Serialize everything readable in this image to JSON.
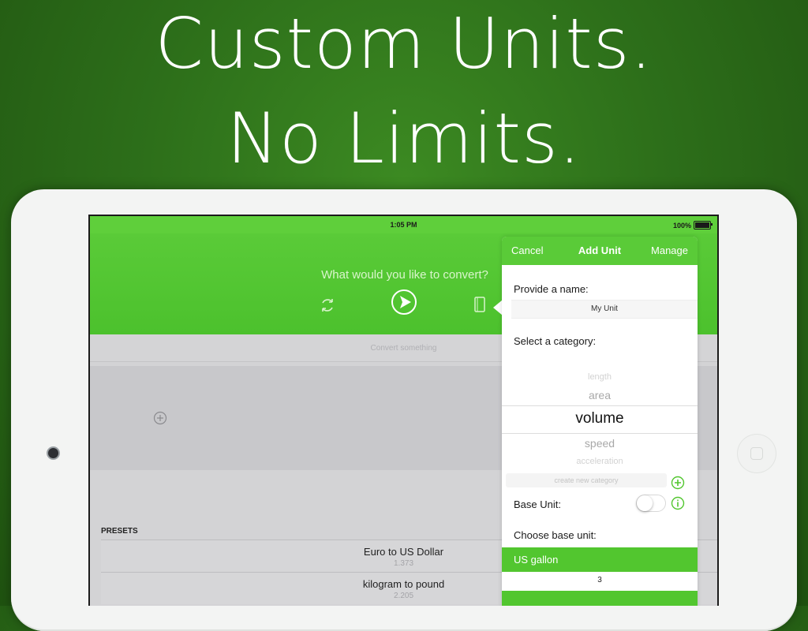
{
  "headline": {
    "line1": "Custom Units.",
    "line2": "No Limits."
  },
  "status_bar": {
    "time": "1:05 PM",
    "battery": "100%"
  },
  "main": {
    "prompt": "What would you like to convert?",
    "convert_placeholder": "Convert something",
    "icons": [
      "refresh-icon",
      "play-icon",
      "book-icon",
      "add-icon"
    ]
  },
  "presets": {
    "header": "PRESETS",
    "items": [
      {
        "name": "Euro to US Dollar",
        "value": "1.373"
      },
      {
        "name": "kilogram to pound",
        "value": "2.205"
      }
    ]
  },
  "popover": {
    "cancel": "Cancel",
    "title": "Add Unit",
    "manage": "Manage",
    "name_label": "Provide a name:",
    "name_value": "My Unit",
    "category_label": "Select a category:",
    "categories": [
      "length",
      "area",
      "volume",
      "speed",
      "acceleration"
    ],
    "selected_category": "volume",
    "new_category_placeholder": "create new category",
    "base_unit_label": "Base Unit:",
    "base_unit_on": false,
    "choose_base_label": "Choose base unit:",
    "selected_base_unit": "US gallon",
    "quantity": "3"
  },
  "colors": {
    "accent_green": "#52c62f",
    "background_green": "#2d6f1a"
  }
}
